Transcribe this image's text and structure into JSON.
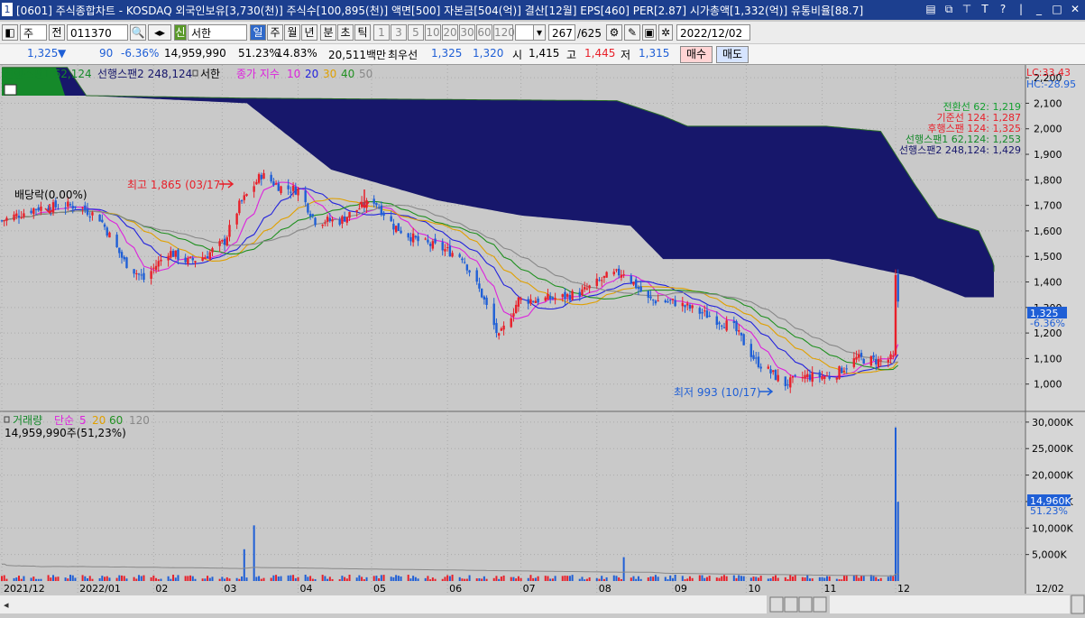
{
  "window": {
    "title_num": "1",
    "title": "[0601] 주식종합차트 - KOSDAQ 외국인보유[3,730(천)] 주식수[100,895(천)] 액면[500] 자본금[504(억)] 결산[12월] EPS[460] PER[2.87] 시가총액[1,332(억)] 유통비율[88.7]"
  },
  "toolbar": {
    "period_type": "주",
    "prev_label": "전",
    "code": "011370",
    "shin_label": "신",
    "stock_name": "서한",
    "periods": [
      "일",
      "주",
      "월",
      "년",
      "분",
      "초",
      "틱"
    ],
    "active_period": "일",
    "intervals": [
      "1",
      "3",
      "5",
      "10",
      "20",
      "30",
      "60",
      "120"
    ],
    "count": "267",
    "count_total": "/625",
    "date": "2022/12/02"
  },
  "quote": {
    "price": "1,325",
    "change_arrow": "▼",
    "change": "90",
    "change_pct": "-6.36%",
    "volume": "14,959,990",
    "volume_ratio": "51.23%",
    "turnover": "14.83%",
    "amount": "20,511백만",
    "best_ask_label": "최우선",
    "best_ask": "1,325",
    "best_bid": "1,320",
    "open_label": "시",
    "open": "1,415",
    "high_label": "고",
    "high": "1,445",
    "low_label": "저",
    "low": "1,315",
    "buy_label": "매수",
    "sell_label": "매도"
  },
  "legend": {
    "span1": "선행스팬1 62,124",
    "span2": "선행스팬2 248,124",
    "stock": "서한",
    "ma_prefix": "종가 지수",
    "ma": [
      "10",
      "20",
      "30",
      "40",
      "50"
    ],
    "ma_colors": [
      "#dd22dd",
      "#2222dd",
      "#e0a000",
      "#209020",
      "#888888"
    ]
  },
  "right_info": {
    "lc": "LC:33.43",
    "hc": "HC:-28.95",
    "conv": "전환선 62: 1,219",
    "base": "기준선 124: 1,287",
    "lag": "후행스팬 124: 1,325",
    "s1": "선행스팬1 62,124: 1,253",
    "s2": "선행스팬2 248,124: 1,429",
    "price_tag": "1,325",
    "pct_tag": "-6.36%",
    "vol_tag": "14,960K",
    "vol_pct_tag": "51.23%"
  },
  "annotations": {
    "dividend": "배당락(0.00%)",
    "high": "최고 1,865 (03/17)",
    "low": "최저 993 (10/17)"
  },
  "volume_legend": {
    "title": "거래량",
    "ma_prefix": "단순",
    "ma": [
      "5",
      "20",
      "60",
      "120"
    ],
    "ma_colors": [
      "#dd22dd",
      "#e0a000",
      "#209020",
      "#888888"
    ],
    "current": "14,959,990주(51,23%)"
  },
  "colors": {
    "up": "#e8202a",
    "down": "#1f5fd6",
    "cloud_bear": "#17176b",
    "cloud_bull": "#15892a",
    "bg": "#c9c9c9"
  },
  "chart_data": {
    "type": "candlestick",
    "ylim": [
      900,
      2250
    ],
    "y_ticks": [
      "1,000",
      "1,100",
      "1,200",
      "1,300",
      "1,400",
      "1,500",
      "1,600",
      "1,700",
      "1,800",
      "1,900",
      "2,000",
      "2,100",
      "2,200"
    ],
    "vol_ticks": [
      "5,000K",
      "10,000K",
      "15,000K",
      "20,000K",
      "25,000K",
      "30,000K"
    ],
    "vol_ylim": [
      0,
      31000
    ],
    "x_labels": [
      "2021/12",
      "2022/01",
      "02",
      "03",
      "04",
      "05",
      "06",
      "07",
      "08",
      "09",
      "10",
      "11",
      "12",
      "12/02"
    ],
    "x_label_dates": [
      "2021-12-01",
      "2022-01-01",
      "2022-02-01",
      "2022-03-01",
      "2022-04-01",
      "2022-05-01",
      "2022-06-01",
      "2022-07-01",
      "2022-08-01",
      "2022-09-01",
      "2022-10-01",
      "2022-11-01",
      "2022-12-01",
      "2022-12-02"
    ],
    "price_path": [
      [
        "2021-12-01",
        1640
      ],
      [
        "2021-12-15",
        1690
      ],
      [
        "2022-01-01",
        1700
      ],
      [
        "2022-01-10",
        1650
      ],
      [
        "2022-01-20",
        1480
      ],
      [
        "2022-01-28",
        1410
      ],
      [
        "2022-02-07",
        1520
      ],
      [
        "2022-02-15",
        1480
      ],
      [
        "2022-02-22",
        1500
      ],
      [
        "2022-03-02",
        1560
      ],
      [
        "2022-03-08",
        1700
      ],
      [
        "2022-03-17",
        1820
      ],
      [
        "2022-03-25",
        1770
      ],
      [
        "2022-04-01",
        1760
      ],
      [
        "2022-04-08",
        1640
      ],
      [
        "2022-04-18",
        1640
      ],
      [
        "2022-04-26",
        1690
      ],
      [
        "2022-05-02",
        1720
      ],
      [
        "2022-05-10",
        1620
      ],
      [
        "2022-05-20",
        1560
      ],
      [
        "2022-05-30",
        1530
      ],
      [
        "2022-06-07",
        1500
      ],
      [
        "2022-06-15",
        1350
      ],
      [
        "2022-06-22",
        1180
      ],
      [
        "2022-06-30",
        1330
      ],
      [
        "2022-07-08",
        1330
      ],
      [
        "2022-07-18",
        1340
      ],
      [
        "2022-07-26",
        1360
      ],
      [
        "2022-08-05",
        1420
      ],
      [
        "2022-08-12",
        1440
      ],
      [
        "2022-08-22",
        1330
      ],
      [
        "2022-09-02",
        1320
      ],
      [
        "2022-09-15",
        1270
      ],
      [
        "2022-09-26",
        1220
      ],
      [
        "2022-10-05",
        1090
      ],
      [
        "2022-10-17",
        1000
      ],
      [
        "2022-10-25",
        1030
      ],
      [
        "2022-11-05",
        1030
      ],
      [
        "2022-11-15",
        1100
      ],
      [
        "2022-11-25",
        1090
      ],
      [
        "2022-11-30",
        1100
      ],
      [
        "2022-12-01",
        1415
      ],
      [
        "2022-12-02",
        1325
      ]
    ],
    "volume_spikes": [
      [
        "2022-03-14",
        10500
      ],
      [
        "2022-03-10",
        6000
      ],
      [
        "2022-08-12",
        4500
      ],
      [
        "2022-12-01",
        29000
      ],
      [
        "2022-12-02",
        14960
      ]
    ],
    "cloud_top_path": [
      [
        "2021-12-01",
        2240
      ],
      [
        "2021-12-25",
        2240
      ],
      [
        "2022-01-01",
        2130
      ],
      [
        "2022-03-01",
        2120
      ],
      [
        "2022-07-15",
        2110
      ],
      [
        "2022-08-01",
        2050
      ],
      [
        "2022-08-10",
        2010
      ],
      [
        "2022-09-30",
        2010
      ],
      [
        "2022-10-20",
        1990
      ],
      [
        "2022-11-01",
        1790
      ],
      [
        "2022-11-10",
        1650
      ],
      [
        "2022-11-25",
        1600
      ],
      [
        "2022-12-02",
        1440
      ]
    ],
    "cloud_bottom_path": [
      [
        "2021-12-01",
        2130
      ],
      [
        "2022-01-01",
        2130
      ],
      [
        "2022-03-01",
        2100
      ],
      [
        "2022-04-01",
        1840
      ],
      [
        "2022-05-10",
        1720
      ],
      [
        "2022-06-10",
        1660
      ],
      [
        "2022-07-01",
        1640
      ],
      [
        "2022-07-20",
        1620
      ],
      [
        "2022-08-01",
        1490
      ],
      [
        "2022-10-01",
        1490
      ],
      [
        "2022-11-01",
        1420
      ],
      [
        "2022-11-20",
        1340
      ],
      [
        "2022-12-02",
        1340
      ]
    ]
  }
}
